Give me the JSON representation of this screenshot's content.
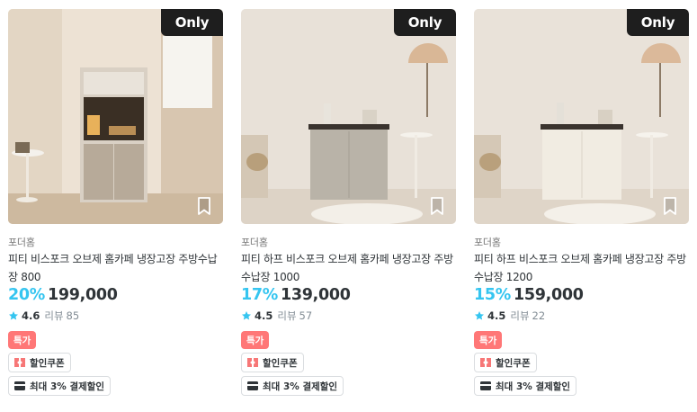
{
  "products": [
    {
      "badge": "Only",
      "brand": "포더홈",
      "title": "피티 비스포크 오브제 홈카페 냉장고장 주방수납장 800",
      "discount": "20%",
      "price": "199,000",
      "rating": "4.6",
      "review_label": "리뷰",
      "review_count": "85",
      "special_label": "특가",
      "coupon_label": "할인쿠폰",
      "payment_label": "최대 3% 결제할인",
      "image_variant": "tall-cabinet"
    },
    {
      "badge": "Only",
      "brand": "포더홈",
      "title": "피티 하프 비스포크 오브제 홈카페 냉장고장 주방수납장 1000",
      "discount": "17%",
      "price": "139,000",
      "rating": "4.5",
      "review_label": "리뷰",
      "review_count": "57",
      "special_label": "특가",
      "coupon_label": "할인쿠폰",
      "payment_label": "최대 3% 결제할인",
      "image_variant": "half-cabinet-gray"
    },
    {
      "badge": "Only",
      "brand": "포더홈",
      "title": "피티 하프 비스포크 오브제 홈카페 냉장고장 주방수납장 1200",
      "discount": "15%",
      "price": "159,000",
      "rating": "4.5",
      "review_label": "리뷰",
      "review_count": "22",
      "special_label": "특가",
      "coupon_label": "할인쿠폰",
      "payment_label": "최대 3% 결제할인",
      "image_variant": "half-cabinet-white"
    }
  ],
  "colors": {
    "discount": "#35c5f0",
    "star": "#35c5f0",
    "special_badge": "#ff7777",
    "coupon_icon": "#f77777",
    "badge_bg": "#1e1e1e"
  },
  "icons": {
    "scrap": "bookmark-icon",
    "rating": "star-icon",
    "coupon": "ticket-icon",
    "payment": "card-icon"
  }
}
